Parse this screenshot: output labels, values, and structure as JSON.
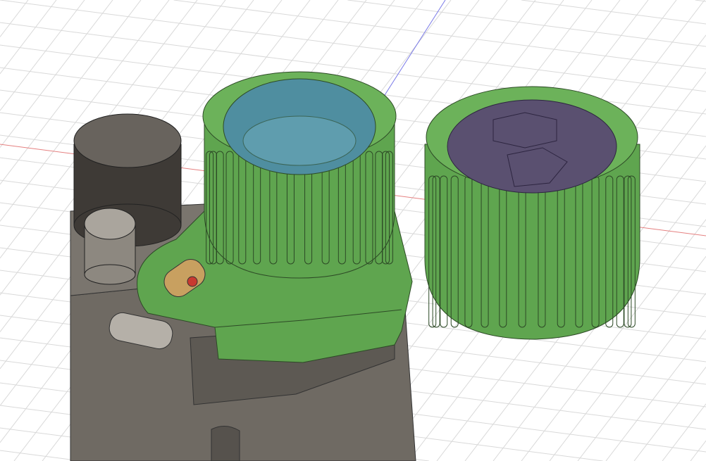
{
  "viewport": {
    "background": "#ffffff",
    "grid_color": "#d9d9d9",
    "x_axis_color": "#e05050",
    "y_axis_color": "#5050e0"
  },
  "model": {
    "body_color": "#6f6a63",
    "cap_color": "#5fa54f",
    "cap_dark": "#3f7d35",
    "lens_color": "#4f8ea0",
    "filter_color": "#5a5070",
    "knob_color": "#5b5650",
    "pin_color": "#c8a060",
    "button_color": "#c83a30"
  }
}
